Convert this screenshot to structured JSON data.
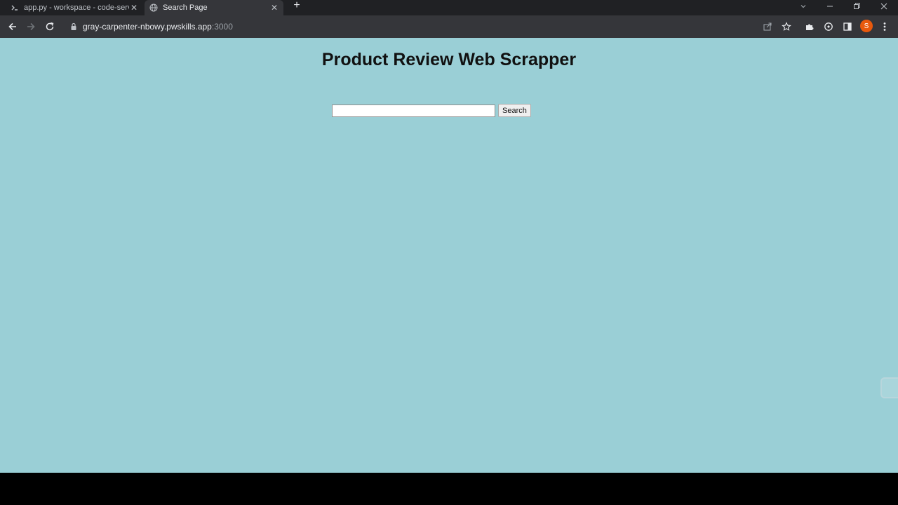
{
  "browser": {
    "tabs": [
      {
        "title": "app.py - workspace - code-serve",
        "icon": "code-server-icon",
        "active": false
      },
      {
        "title": "Search Page",
        "icon": "globe-icon",
        "active": true
      }
    ],
    "url_host": "gray-carpenter-nbowy.pwskills.app",
    "url_port": ":3000",
    "profile_initial": "S",
    "colors": {
      "tabstrip": "#202124",
      "toolbar": "#35363a",
      "avatar": "#e8590c"
    }
  },
  "page": {
    "title": "Product Review Web Scrapper",
    "search_value": "",
    "search_button": "Search",
    "background": "#9acfd6"
  }
}
